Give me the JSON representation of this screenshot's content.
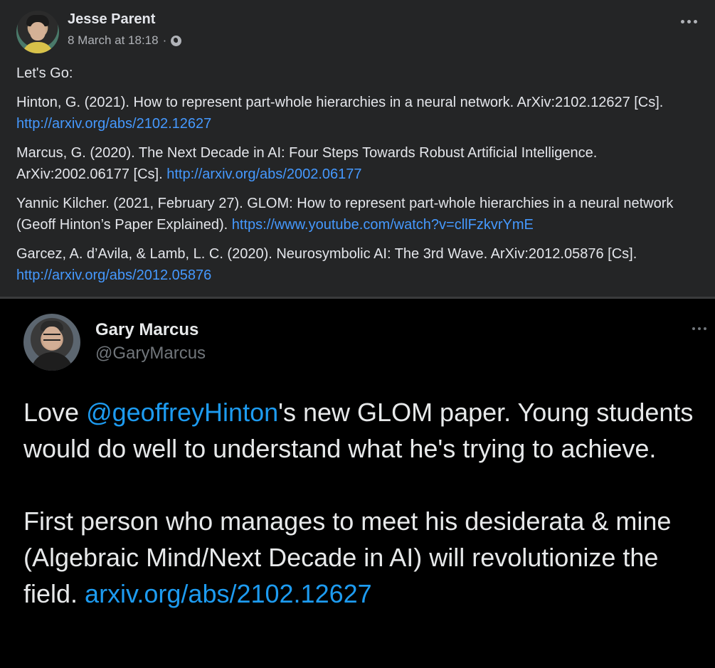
{
  "fb_post": {
    "author": "Jesse Parent",
    "timestamp": "8 March at 18:18",
    "separator": "·",
    "intro": "Let's Go:",
    "references": [
      {
        "text": "Hinton, G. (2021). How to represent part-whole hierarchies in a neural network. ArXiv:2102.12627 [Cs].",
        "link": "http://arxiv.org/abs/2102.12627"
      },
      {
        "text": "Marcus, G. (2020). The Next Decade in AI: Four Steps Towards Robust Artificial Intelligence. ArXiv:2002.06177 [Cs].",
        "link": "http://arxiv.org/abs/2002.06177"
      },
      {
        "text": "Yannic Kilcher. (2021, February 27). GLOM: How to represent part-whole hierarchies in a neural network (Geoff Hinton’s Paper Explained).",
        "link": "https://www.youtube.com/watch?v=cllFzkvrYmE"
      },
      {
        "text": "Garcez, A. d’Avila, & Lamb, L. C. (2020). Neurosymbolic AI: The 3rd Wave. ArXiv:2012.05876 [Cs].",
        "link": "http://arxiv.org/abs/2012.05876"
      }
    ]
  },
  "tweet": {
    "name": "Gary Marcus",
    "handle": "@GaryMarcus",
    "para1": {
      "pre": "Love ",
      "mention": "@geoffreyHinton",
      "post": "'s new GLOM paper.  Young students would do well to understand what he's trying to achieve."
    },
    "para2": {
      "text": "First person who manages to meet his desiderata & mine (Algebraic Mind/Next Decade in AI) will revolutionize the field. ",
      "link": "arxiv.org/abs/2102.12627"
    }
  },
  "colors": {
    "fb_background": "#242526",
    "fb_link": "#4599ff",
    "tweet_background": "#000000",
    "tweet_link": "#1d9bf0"
  },
  "icons": {
    "fb_privacy": "globe-icon",
    "fb_options": "more-options-icon",
    "tweet_options": "more-options-icon"
  }
}
